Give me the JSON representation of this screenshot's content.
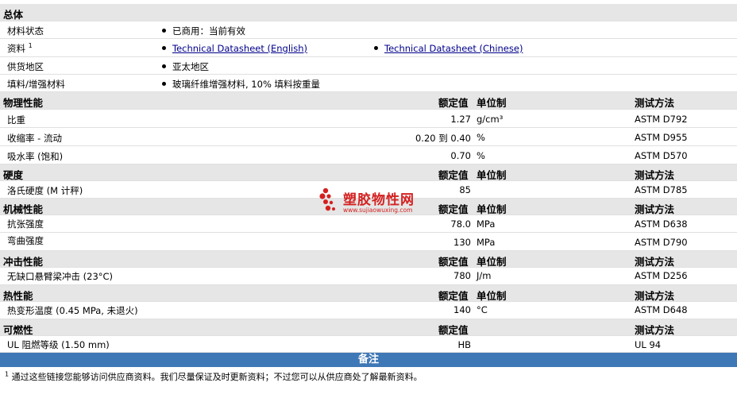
{
  "general": {
    "title": "总体",
    "status": {
      "label": "材料状态",
      "value": "已商用：当前有效"
    },
    "resources": {
      "label": "资料",
      "sup": "1",
      "link_en": "Technical Datasheet (English)",
      "link_cn": "Technical Datasheet (Chinese)"
    },
    "region": {
      "label": "供货地区",
      "value": "亚太地区"
    },
    "filler": {
      "label": "填料/增强材料",
      "value": "玻璃纤维增强材料, 10% 填料按重量"
    }
  },
  "headers": {
    "rated": "额定值",
    "unit": "单位制",
    "method": "测试方法"
  },
  "sections": [
    {
      "title": "物理性能",
      "has_unit": true,
      "rows": [
        {
          "label": "比重",
          "value": "1.27",
          "unit": "g/cm³",
          "method": "ASTM D792"
        },
        {
          "label": "收缩率 - 流动",
          "value": "0.20 到  0.40",
          "unit": "%",
          "method": "ASTM D955"
        },
        {
          "label": "吸水率 (饱和)",
          "value": "0.70",
          "unit": "%",
          "method": "ASTM D570"
        }
      ]
    },
    {
      "title": "硬度",
      "has_unit": true,
      "rows": [
        {
          "label": "洛氏硬度 (M 计秤)",
          "value": "85",
          "unit": "",
          "method": "ASTM D785"
        }
      ]
    },
    {
      "title": "机械性能",
      "has_unit": true,
      "rows": [
        {
          "label": "抗张强度",
          "value": "78.0",
          "unit": "MPa",
          "method": "ASTM D638"
        },
        {
          "label": "弯曲强度",
          "value": "130",
          "unit": "MPa",
          "method": "ASTM D790"
        }
      ]
    },
    {
      "title": "冲击性能",
      "has_unit": true,
      "rows": [
        {
          "label": "无缺口悬臂梁冲击 (23°C)",
          "value": "780",
          "unit": "J/m",
          "method": "ASTM D256"
        }
      ]
    },
    {
      "title": "热性能",
      "has_unit": true,
      "rows": [
        {
          "label": "热变形温度 (0.45 MPa, 未退火)",
          "value": "140",
          "unit": "°C",
          "method": "ASTM D648"
        }
      ]
    },
    {
      "title": "可燃性",
      "has_unit": false,
      "rows": [
        {
          "label": "UL 阻燃等级 (1.50 mm)",
          "value": "HB",
          "unit": "",
          "method": "UL 94"
        }
      ]
    }
  ],
  "notes": {
    "title": "备注",
    "sup": "1",
    "text": "通过这些链接您能够访问供应商资料。我们尽量保证及时更新资料；不过您可以从供应商处了解最新资料。"
  },
  "watermark": {
    "title": "塑胶物性网",
    "sub": "www.sujiaowuxing.com"
  }
}
